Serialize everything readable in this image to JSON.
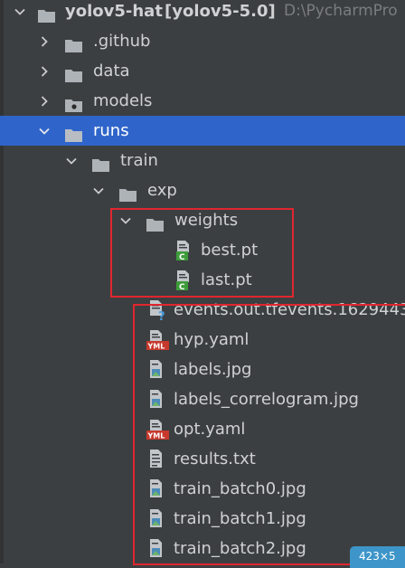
{
  "tree": {
    "root": {
      "name": "yolov5-hat",
      "module": "[yolov5-5.0]",
      "path": "D:\\PycharmPro"
    },
    "items": [
      {
        "label": ".github"
      },
      {
        "label": "data"
      },
      {
        "label": "models"
      },
      {
        "label": "runs"
      },
      {
        "label": "train"
      },
      {
        "label": "exp"
      },
      {
        "label": "weights"
      },
      {
        "label": "best.pt"
      },
      {
        "label": "last.pt"
      },
      {
        "label": "events.out.tfevents.1629443"
      },
      {
        "label": "hyp.yaml"
      },
      {
        "label": "labels.jpg"
      },
      {
        "label": "labels_correlogram.jpg"
      },
      {
        "label": "opt.yaml"
      },
      {
        "label": "results.txt"
      },
      {
        "label": "train_batch0.jpg"
      },
      {
        "label": "train_batch1.jpg"
      },
      {
        "label": "train_batch2.jpg"
      }
    ]
  },
  "overlay": {
    "size_badge": "423×5"
  },
  "colors": {
    "background": "#3c3f41",
    "selection": "#2f65ca",
    "highlight_box": "#e0262f",
    "badge": "#3d95c9"
  },
  "icons": {
    "folder": "folder-icon",
    "module_folder": "module-folder-icon",
    "python_file": "python-file-icon",
    "unknown_file": "unknown-file-icon",
    "yaml_file": "yaml-file-icon",
    "image_file": "image-file-icon",
    "text_file": "text-file-icon"
  }
}
